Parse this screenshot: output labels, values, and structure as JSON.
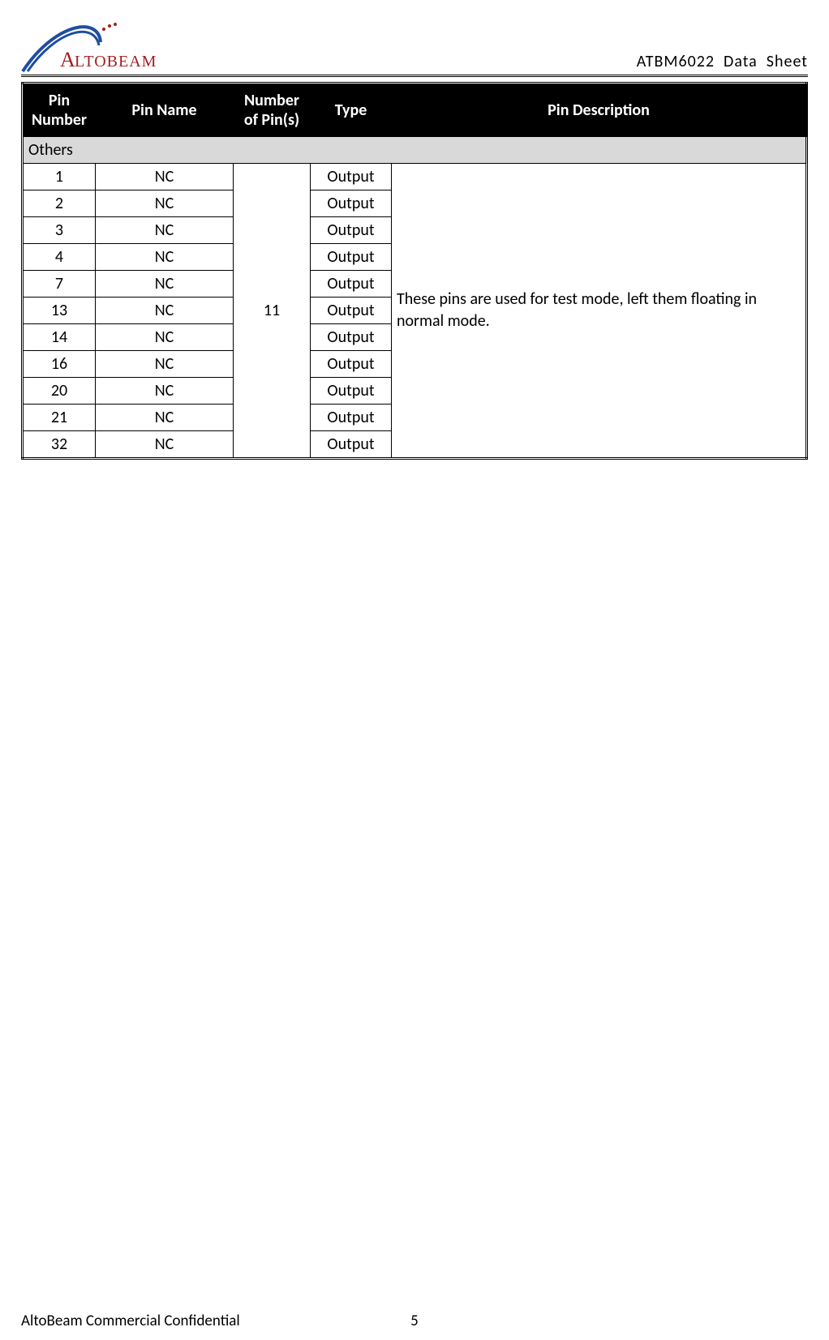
{
  "header": {
    "logo_text": "ALTOBEAM",
    "doc_title": "ATBM6022  Data  Sheet"
  },
  "table": {
    "columns": {
      "pin_number": "Pin Number",
      "pin_name": "Pin Name",
      "number_of_pins": "Number of Pin(s)",
      "type": "Type",
      "pin_description": "Pin Description"
    },
    "section_label": "Others",
    "merged_number_of_pins": "11",
    "merged_description": "These pins are used for test mode, left them floating in normal mode.",
    "rows": [
      {
        "pin_number": "1",
        "pin_name": "NC",
        "type": "Output"
      },
      {
        "pin_number": "2",
        "pin_name": "NC",
        "type": "Output"
      },
      {
        "pin_number": "3",
        "pin_name": "NC",
        "type": "Output"
      },
      {
        "pin_number": "4",
        "pin_name": "NC",
        "type": "Output"
      },
      {
        "pin_number": "7",
        "pin_name": "NC",
        "type": "Output"
      },
      {
        "pin_number": "13",
        "pin_name": "NC",
        "type": "Output"
      },
      {
        "pin_number": "14",
        "pin_name": "NC",
        "type": "Output"
      },
      {
        "pin_number": "16",
        "pin_name": "NC",
        "type": "Output"
      },
      {
        "pin_number": "20",
        "pin_name": "NC",
        "type": "Output"
      },
      {
        "pin_number": "21",
        "pin_name": "NC",
        "type": "Output"
      },
      {
        "pin_number": "32",
        "pin_name": "NC",
        "type": "Output"
      }
    ]
  },
  "footer": {
    "left": "AltoBeam Commercial Confidential",
    "page": "5"
  }
}
